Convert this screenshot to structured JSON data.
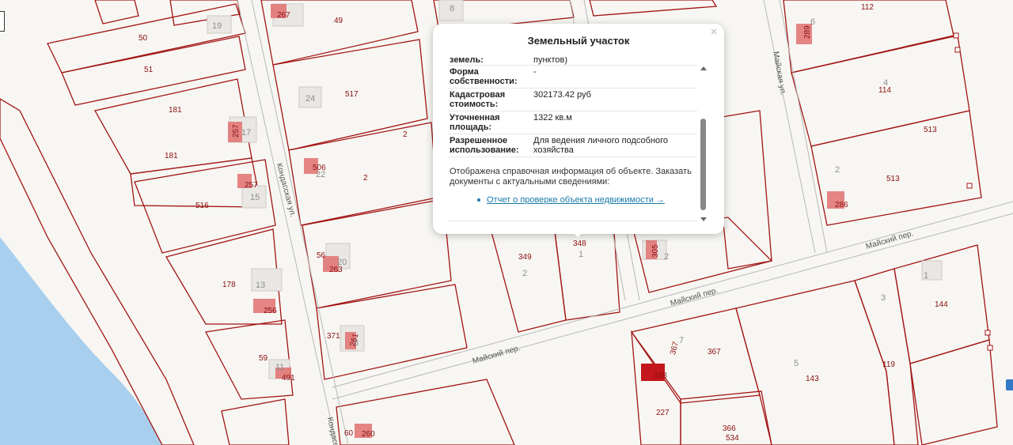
{
  "map": {
    "streets": {
      "kondasskaya": "Кондасская ул.",
      "kondasskaya_short": "Кондасс",
      "mayskaya": "Майская ул.",
      "maysky_per_1": "Майский пер.",
      "maysky_per_2": "Майский пер.",
      "maysky_per_3": "Майский пер."
    },
    "plot_labels": [
      "50",
      "51",
      "181",
      "181",
      "516",
      "178",
      "59",
      "491",
      "267",
      "49",
      "517",
      "2",
      "2",
      "506",
      "22",
      "257",
      "15",
      "13",
      "256",
      "371",
      "261",
      "8",
      "56",
      "263",
      "20",
      "60",
      "260",
      "8",
      "349",
      "348",
      "1",
      "2",
      "305",
      "2",
      "367",
      "7",
      "367",
      "338",
      "227",
      "366",
      "534",
      "5",
      "143",
      "119",
      "3",
      "144",
      "112",
      "6",
      "289",
      "4",
      "114",
      "513",
      "2",
      "513",
      "286",
      "1",
      "24",
      "19",
      "17",
      "257",
      "11"
    ]
  },
  "popup": {
    "title": "Земельный участок",
    "close": "×",
    "rows": [
      {
        "key": "земель:",
        "value": "пунктов)"
      },
      {
        "key": "Форма собственности:",
        "value": "-"
      },
      {
        "key": "Кадастровая стоимость:",
        "value": "302173.42 руб"
      },
      {
        "key": "Уточненная площадь:",
        "value": "1322 кв.м"
      },
      {
        "key": "Разрешенное использование:",
        "value": "Для ведения личного подсобного хозяйства"
      }
    ],
    "note": "Отображена справочная информация об объекте. Заказать документы с актуальными сведениями:",
    "link": "Отчет о проверке объекта недвижимости →"
  },
  "colors": {
    "boundary": "#a21414",
    "water": "#a9cfee",
    "building": "#e07070",
    "highlight": "#c4161c",
    "link": "#1a7aa8"
  }
}
